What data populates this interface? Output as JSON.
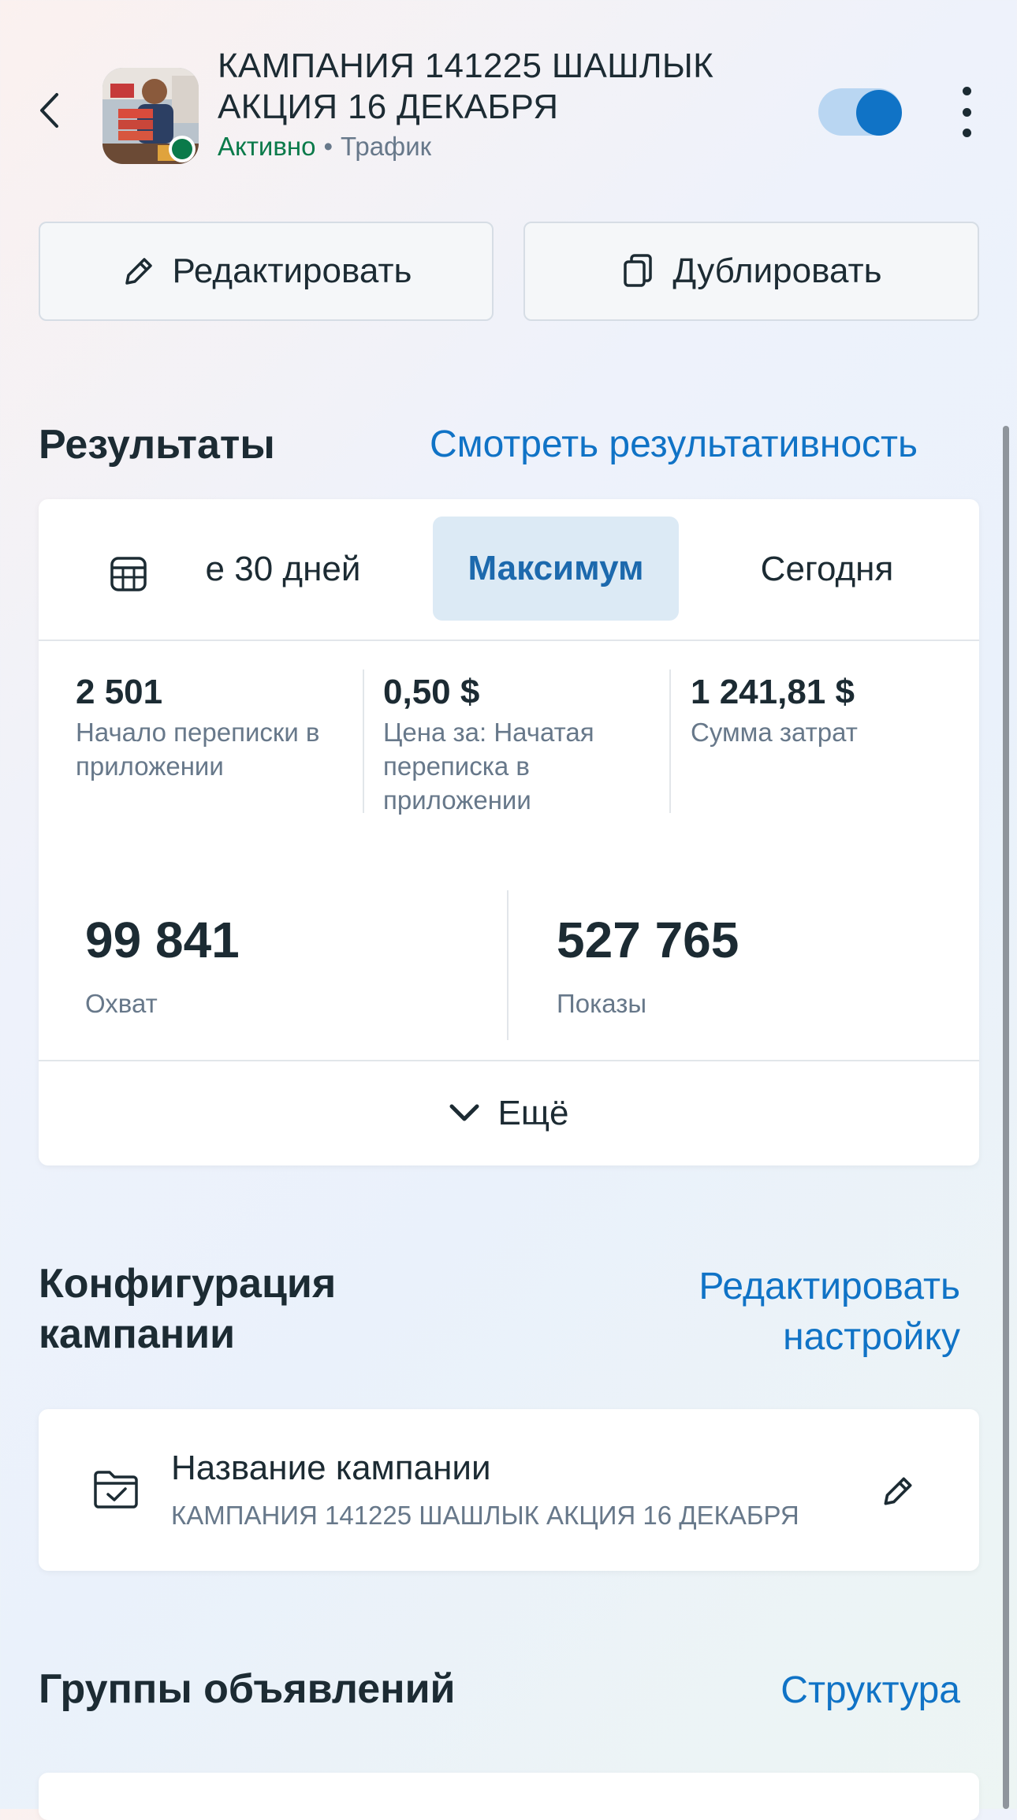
{
  "header": {
    "title": "КАМПАНИЯ 141225 ШАШЛЫК АКЦИЯ 16 ДЕКАБРЯ",
    "status": "Активно",
    "separator": "•",
    "objective": "Трафик",
    "toggle_on": true
  },
  "actions": {
    "edit_label": "Редактировать",
    "duplicate_label": "Дублировать"
  },
  "results": {
    "heading": "Результаты",
    "link": "Смотреть результативность",
    "tabs": [
      {
        "label": "е 30 дней",
        "selected": false
      },
      {
        "label": "Максимум",
        "selected": true
      },
      {
        "label": "Сегодня",
        "selected": false
      }
    ],
    "metrics": [
      {
        "value": "2 501",
        "label": "Начало переписки в приложении"
      },
      {
        "value": "0,50 $",
        "label": "Цена за: Начатая переписка в приложении"
      },
      {
        "value": "1 241,81 $",
        "label": "Сумма затрат"
      }
    ],
    "big_metrics": [
      {
        "value": "99 841",
        "label": "Охват"
      },
      {
        "value": "527 765",
        "label": "Показы"
      }
    ],
    "more_label": "Ещё"
  },
  "config": {
    "heading_line1": "Конфигурация",
    "heading_line2": "кампании",
    "link_line1": "Редактировать",
    "link_line2": "настройку",
    "campaign_name_label": "Название кампании",
    "campaign_name_value": "КАМПАНИЯ 141225 ШАШЛЫК АКЦИЯ 16 ДЕКАБРЯ"
  },
  "adsets": {
    "heading": "Группы объявлений",
    "link": "Структура"
  },
  "colors": {
    "accent": "#1073c6",
    "active_green": "#0a7a4a",
    "text": "#1c2b33",
    "muted": "#67788a"
  }
}
